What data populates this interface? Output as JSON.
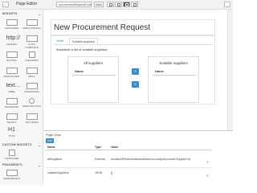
{
  "topbar": {
    "title": "Page Editor",
    "page_name": "procurementRequestForm",
    "save_label": "Save"
  },
  "sidebar": {
    "widgets_header": "WIDGETS",
    "custom_widgets_header": "CUSTOM WIDGETS",
    "fragments_header": "FRAGMENTS",
    "widgets": [
      {
        "label": "CONTAINER"
      },
      {
        "label": "TABS CONTROL"
      },
      {
        "label": "HEADER"
      },
      {
        "label": "AUTO COMPLETE"
      },
      {
        "label": "BUTTON"
      },
      {
        "label": "CHECKBOX"
      },
      {
        "label": "DATE PICKER"
      },
      {
        "label": "INPUT"
      },
      {
        "label": "LABEL"
      },
      {
        "label": "PARAGRAPH"
      },
      {
        "label": "PASSWORD"
      },
      {
        "label": "RADIO BUTTON"
      },
      {
        "label": "SELECT"
      },
      {
        "label": "TEXT AREA"
      },
      {
        "label": "TITLE"
      }
    ],
    "header_glyph": "http://",
    "label_glyph": "text…",
    "title_glyph": "H1",
    "custom_widget": {
      "label": "LISTPICKER"
    },
    "fragment": {
      "label": "SUPPLIERLIST"
    }
  },
  "canvas": {
    "page_title": "New Procurement Request",
    "tabs": [
      {
        "label": "Home"
      },
      {
        "label": "Suitable suppliers"
      }
    ],
    "instruction": "Assemble a list of suitable suppliers.",
    "left_panel": {
      "title": "All suppliers",
      "column": "Name"
    },
    "right_panel": {
      "title": "Suitable suppliers",
      "column": "Name"
    },
    "move_right": "»",
    "move_left": "«"
  },
  "page_data": {
    "title": "Page Data",
    "add_label": "Add",
    "columns": [
      "Name",
      "Type",
      "Value"
    ],
    "rows": [
      {
        "name": "allSuppliers",
        "type": "External",
        "value": "/bonita/API/bdm/businessData/com.company.model.Supplier?q=",
        "action": "✎"
      },
      {
        "name": "suitableSuppliers",
        "type": "JSON",
        "value": "[]",
        "action": "✎"
      }
    ]
  }
}
